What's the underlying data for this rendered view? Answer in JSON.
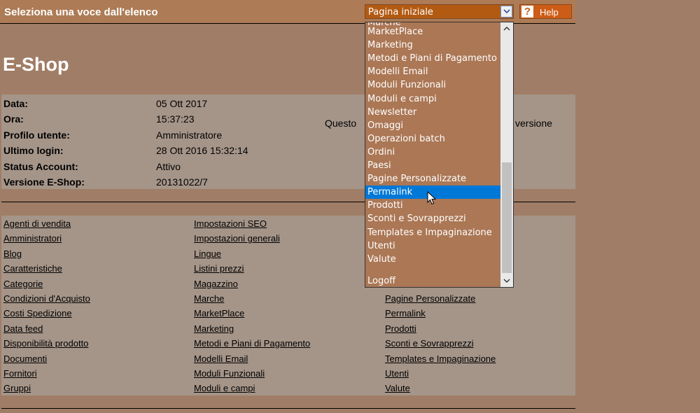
{
  "header": {
    "prompt": "Seleziona una voce dall'elenco",
    "select_value": "Pagina iniziale",
    "help_label": "Help",
    "help_glyph": "?"
  },
  "page_title": "E-Shop",
  "info": {
    "rows": [
      {
        "label": "Data:",
        "value": "05 Ott 2017"
      },
      {
        "label": "Ora:",
        "value": "15:37:23"
      },
      {
        "label": "Profilo utente:",
        "value": "Amministratore"
      },
      {
        "label": "Ultimo login:",
        "value": "28 Ott 2016 15:32:14"
      },
      {
        "label": "Status Account:",
        "value": "Attivo"
      },
      {
        "label": "Versione E-Shop:",
        "value": "20131022/7"
      }
    ],
    "notice_start": "Questo",
    "notice_end": "versione"
  },
  "links": {
    "col1": [
      "Agenti di vendita",
      "Amministratori",
      "Blog",
      "Caratteristiche",
      "Categorie",
      "Condizioni d'Acquisto",
      "Costi Spedizione",
      "Data feed",
      "Disponibilità prodotto",
      "Documenti",
      "Fornitori",
      "Gruppi"
    ],
    "col2": [
      "Impostazioni SEO",
      "Impostazioni generali",
      "Lingue",
      "Listini prezzi",
      "Magazzino",
      "Marche",
      "MarketPlace",
      "Marketing",
      "Metodi e Piani di Pagamento",
      "Modelli Email",
      "Moduli Funzionali",
      "Moduli e campi"
    ],
    "col3": [
      "Pagine Personalizzate",
      "Permalink",
      "Prodotti",
      "Sconti e Sovrapprezzi",
      "Templates e Impaginazione",
      "Utenti",
      "Valute"
    ]
  },
  "dropdown": {
    "partial_top": "Marche",
    "items": [
      "MarketPlace",
      "Marketing",
      "Metodi e Piani di Pagamento",
      "Modelli Email",
      "Moduli Funzionali",
      "Moduli e campi",
      "Newsletter",
      "Omaggi",
      "Operazioni batch",
      "Ordini",
      "Paesi",
      "Pagine Personalizzate",
      "Permalink",
      "Prodotti",
      "Sconti e Sovrapprezzi",
      "Templates e Impaginazione",
      "Utenti",
      "Valute"
    ],
    "selected": "Permalink",
    "logoff": "Logoff"
  }
}
